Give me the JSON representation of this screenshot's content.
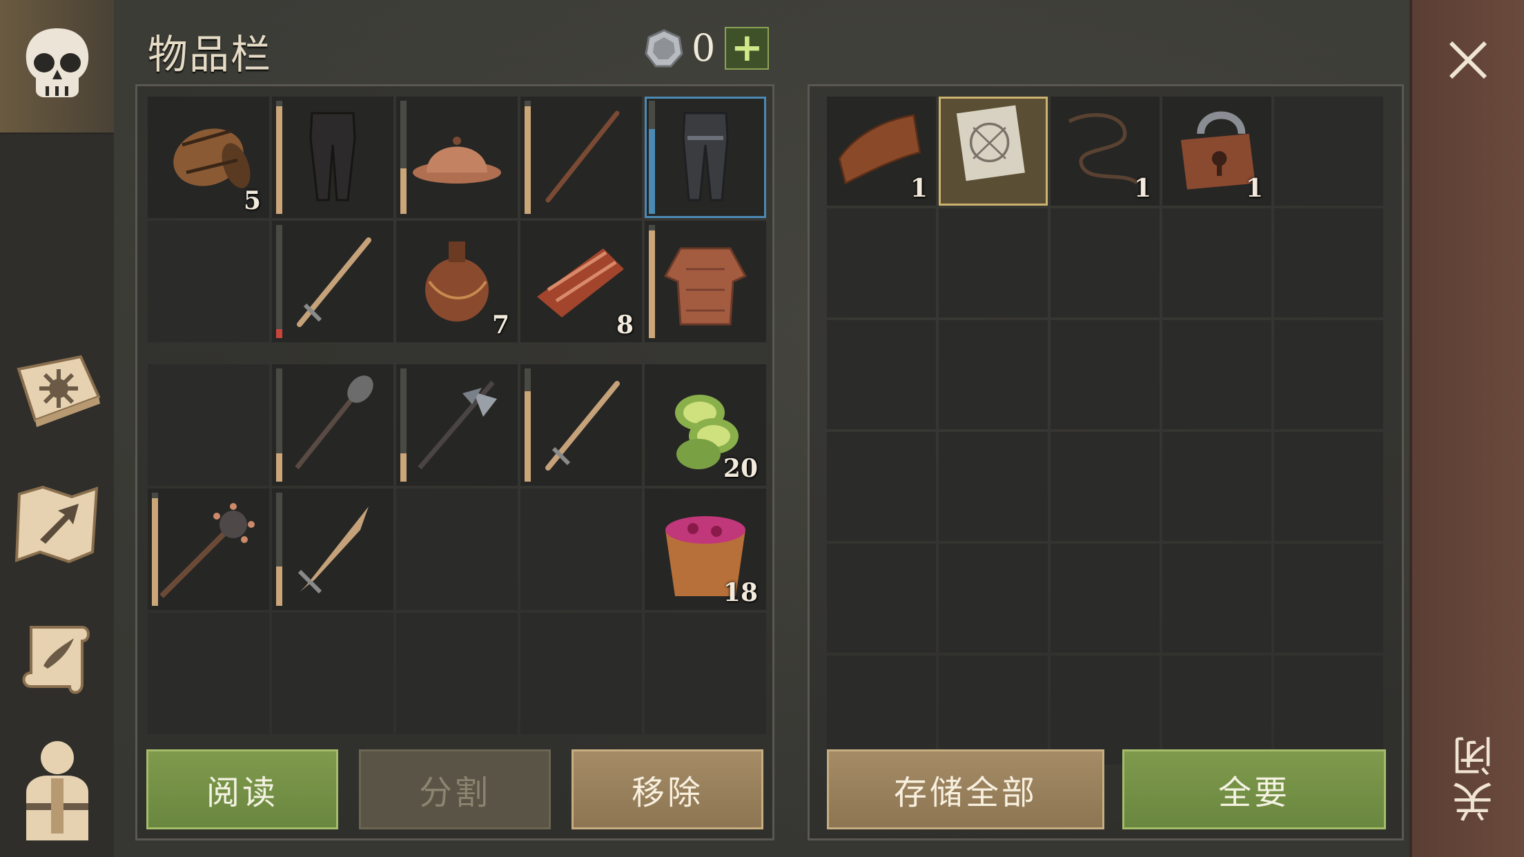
{
  "inventory": {
    "title": "物品栏",
    "currency": {
      "icon": "silver-coin-icon",
      "value": "0",
      "add_label": "+"
    },
    "slots": [
      {
        "item": "barrel-icon",
        "count": "5"
      },
      {
        "item": "leather-pants-icon",
        "durability": 0.95
      },
      {
        "item": "iron-helmet-icon",
        "durability": 0.4
      },
      {
        "item": "wooden-stick-icon",
        "durability": 0.95
      },
      {
        "item": "chainmail-pants-icon",
        "durability": 0.75,
        "selected": true
      },
      {
        "item": "",
        "empty": true
      },
      {
        "item": "sword-icon",
        "durability": 0.08,
        "durability_color": "#c9453a"
      },
      {
        "item": "water-flask-icon",
        "count": "7"
      },
      {
        "item": "raw-meat-icon",
        "count": "8"
      },
      {
        "item": "padded-jacket-icon",
        "durability": 0.95
      },
      {
        "item": "",
        "empty": true
      },
      {
        "item": "mace-icon",
        "durability": 0.25
      },
      {
        "item": "halberd-icon",
        "durability": 0.25
      },
      {
        "item": "sword-icon",
        "durability": 0.8
      },
      {
        "item": "cucumber-slices-icon",
        "count": "20"
      },
      {
        "item": "spiked-mace-icon",
        "durability": 0.95
      },
      {
        "item": "short-sword-icon",
        "durability": 0.35
      },
      {
        "item": "",
        "empty": true
      },
      {
        "item": "",
        "empty": true
      },
      {
        "item": "berry-bucket-icon",
        "count": "18"
      },
      {
        "item": "",
        "empty": true
      },
      {
        "item": "",
        "empty": true
      },
      {
        "item": "",
        "empty": true
      },
      {
        "item": "",
        "empty": true
      },
      {
        "item": "",
        "empty": true
      }
    ],
    "buttons": {
      "read": "阅读",
      "split": "分割",
      "remove": "移除"
    }
  },
  "container": {
    "slots": [
      {
        "item": "leather-scrap-icon",
        "count": "1"
      },
      {
        "item": "blueprint-scroll-icon",
        "count": "",
        "selected": true
      },
      {
        "item": "rope-icon",
        "count": "1"
      },
      {
        "item": "padlock-icon",
        "count": "1"
      }
    ],
    "buttons": {
      "store_all": "存储全部",
      "take_all": "全要"
    }
  },
  "close": {
    "label": "关闭"
  },
  "sidebar": {
    "tabs": [
      "skull-icon",
      "crafting-book-icon",
      "map-icon",
      "quest-scroll-icon",
      "character-icon"
    ]
  },
  "colors": {
    "green": "#7f9a4c",
    "tan": "#a58c66",
    "accent_gold": "#cba678",
    "selected_blue": "#4b8ab5"
  }
}
